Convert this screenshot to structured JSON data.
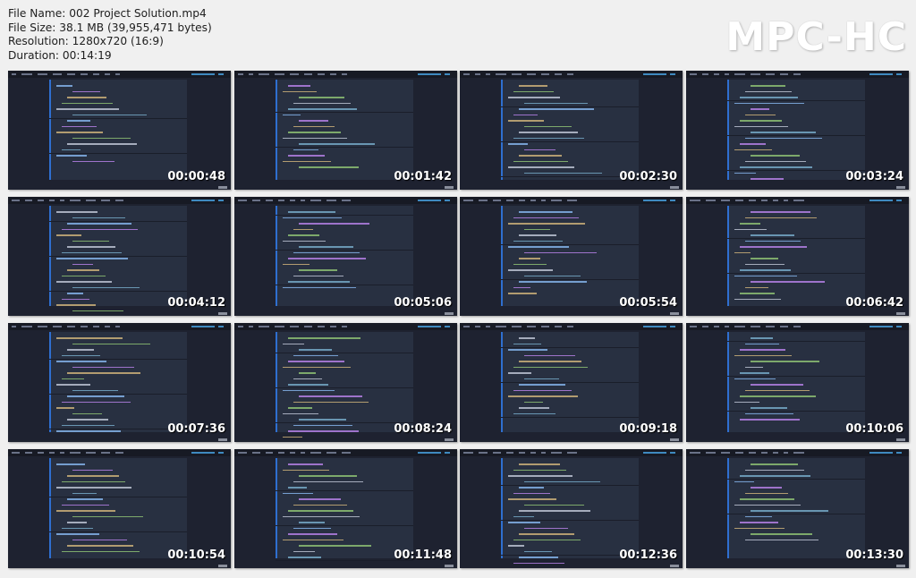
{
  "header": {
    "file_name": "File Name: 002 Project Solution.mp4",
    "file_size": "File Size: 38.1 MB (39,955,471 bytes)",
    "resolution": "Resolution: 1280x720 (16:9)",
    "duration": "Duration: 00:14:19"
  },
  "logo": "MPC-HC",
  "thumbnails": [
    {
      "timestamp": "00:00:48"
    },
    {
      "timestamp": "00:01:42"
    },
    {
      "timestamp": "00:02:30"
    },
    {
      "timestamp": "00:03:24"
    },
    {
      "timestamp": "00:04:12"
    },
    {
      "timestamp": "00:05:06"
    },
    {
      "timestamp": "00:05:54"
    },
    {
      "timestamp": "00:06:42"
    },
    {
      "timestamp": "00:07:36"
    },
    {
      "timestamp": "00:08:24"
    },
    {
      "timestamp": "00:09:18"
    },
    {
      "timestamp": "00:10:06"
    },
    {
      "timestamp": "00:10:54"
    },
    {
      "timestamp": "00:11:48"
    },
    {
      "timestamp": "00:12:36"
    },
    {
      "timestamp": "00:13:30"
    }
  ],
  "colors": {
    "page_background": "#f0f0f0",
    "thumbnail_background": "#1e2230",
    "editor_background": "#283041",
    "timestamp_text": "#ffffff"
  }
}
